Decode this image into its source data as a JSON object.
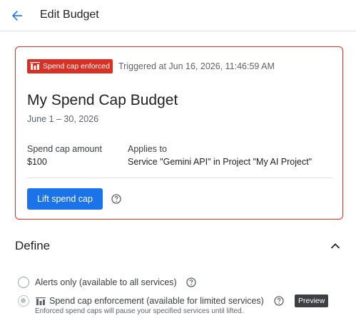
{
  "header": {
    "title": "Edit Budget"
  },
  "card": {
    "badge_label": "Spend cap enforced",
    "triggered": "Triggered at Jun 16, 2026, 11:46:59 AM",
    "budget_name": "My Spend Cap Budget",
    "dates": "June 1 – 30, 2026",
    "amount_label": "Spend cap amount",
    "amount_value": "$100",
    "applies_label": "Applies to",
    "applies_value": "Service \"Gemini API\" in Project \"My AI Project\"",
    "lift_button": "Lift spend cap"
  },
  "define": {
    "title": "Define",
    "options": [
      {
        "label": "Alerts only (available to all services)",
        "selected": false
      },
      {
        "label": "Spend cap enforcement (available for limited services)",
        "selected": true,
        "sublabel": "Enforced spend caps will pause your specified services until lifted.",
        "badge": "Preview"
      }
    ]
  },
  "colors": {
    "accent": "#1a73e8",
    "error": "#d93025",
    "preview_badge": "#3c4043"
  },
  "icons": {
    "back": "arrow-left-icon",
    "badge": "spend-cap-icon",
    "help": "help-circle-icon",
    "collapse": "chevron-up-icon"
  }
}
